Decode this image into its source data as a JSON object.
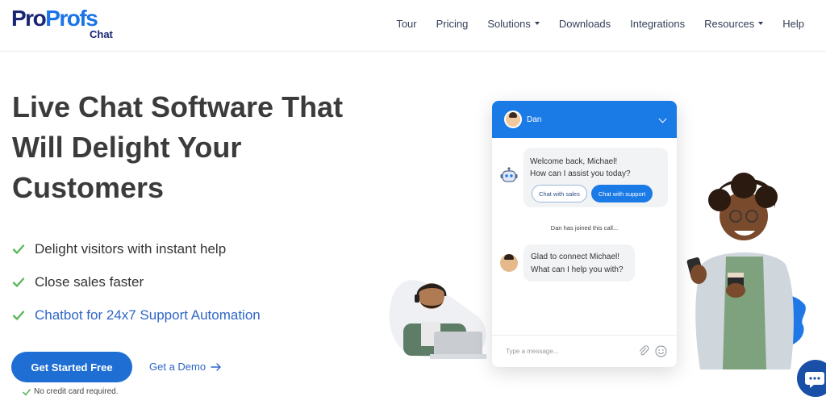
{
  "logo": {
    "part1": "Pro",
    "part2": "Profs",
    "sub": "Chat"
  },
  "nav": [
    {
      "label": "Tour",
      "dropdown": false
    },
    {
      "label": "Pricing",
      "dropdown": false
    },
    {
      "label": "Solutions",
      "dropdown": true
    },
    {
      "label": "Downloads",
      "dropdown": false
    },
    {
      "label": "Integrations",
      "dropdown": false
    },
    {
      "label": "Resources",
      "dropdown": true
    },
    {
      "label": "Help",
      "dropdown": false
    }
  ],
  "hero": {
    "title": "Live Chat Software That Will Delight Your Customers",
    "features": [
      "Delight visitors with instant help",
      "Close sales faster",
      "Chatbot for 24x7 Support Automation"
    ],
    "cta_label": "Get Started Free",
    "demo_label": "Get a Demo",
    "no_credit_card": "No credit card required."
  },
  "widget": {
    "agent_name": "Dan",
    "welcome_line1": "Welcome back, Michael!",
    "welcome_line2": "How can I assist you today?",
    "quick_reply_sales": "Chat with sales",
    "quick_reply_support": "Chat with support",
    "joined_text": "Dan has joined this call...",
    "agent_msg_line1": "Glad to connect Michael!",
    "agent_msg_line2": "What can I help you with?",
    "input_placeholder": "Type a message..."
  },
  "colors": {
    "brand_dark": "#1a2574",
    "brand_blue": "#1a73e8",
    "cta_blue": "#1f6ed4",
    "widget_header": "#1a7ae6",
    "check_green": "#5cb85c",
    "link_blue": "#2f66c6"
  },
  "icons": {
    "check": "check-icon",
    "arrow": "arrow-right-icon",
    "chevron": "chevron-down-icon",
    "bot": "chatbot-icon",
    "attach": "paperclip-icon",
    "emoji": "emoji-icon",
    "chat_launcher": "chat-bubble-icon"
  }
}
